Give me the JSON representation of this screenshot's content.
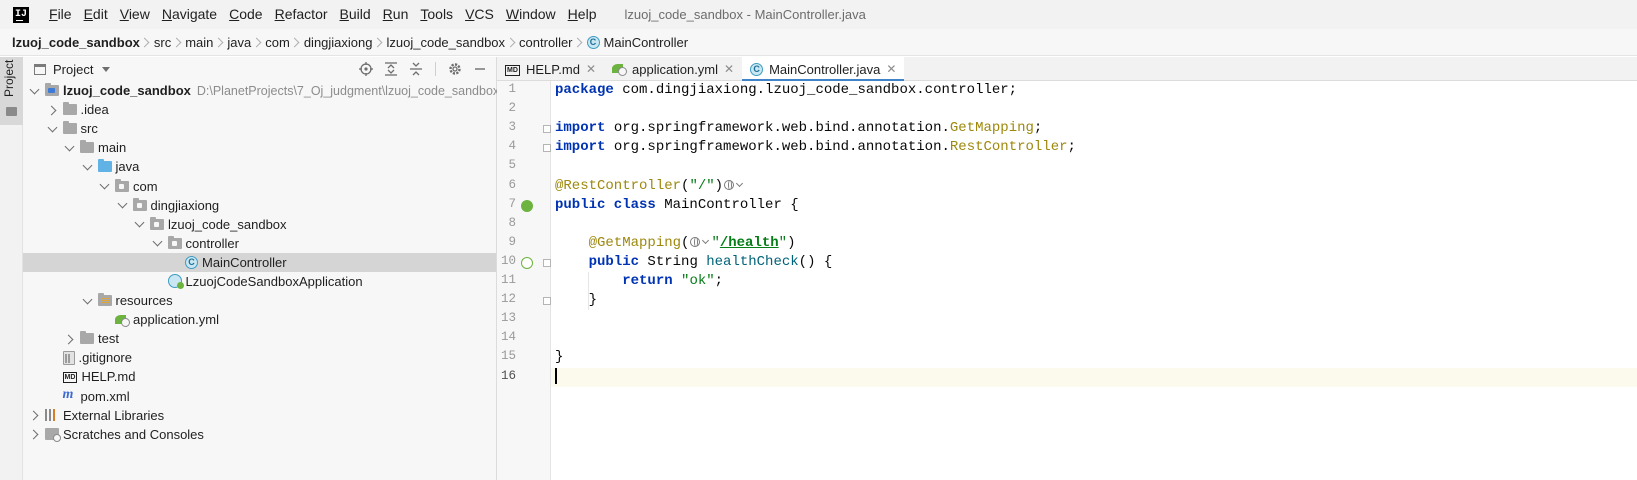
{
  "window": {
    "title": "lzuoj_code_sandbox - MainController.java",
    "logo_text": "IJ"
  },
  "menu": [
    "File",
    "Edit",
    "View",
    "Navigate",
    "Code",
    "Refactor",
    "Build",
    "Run",
    "Tools",
    "VCS",
    "Window",
    "Help"
  ],
  "breadcrumb": [
    "lzuoj_code_sandbox",
    "src",
    "main",
    "java",
    "com",
    "dingjiaxiong",
    "lzuoj_code_sandbox",
    "controller",
    "MainController"
  ],
  "toolstrip": {
    "label": "Project"
  },
  "project_panel": {
    "title": "Project",
    "tree": [
      {
        "label": "lzuoj_code_sandbox",
        "path": "D:\\PlanetProjects\\7_Oj_judgment\\lzuoj_code_sandbox",
        "depth": 0,
        "arrow": "open",
        "icon": "folder-mod",
        "bold": true
      },
      {
        "label": ".idea",
        "depth": 1,
        "arrow": "closed",
        "icon": "folder"
      },
      {
        "label": "src",
        "depth": 1,
        "arrow": "open",
        "icon": "folder"
      },
      {
        "label": "main",
        "depth": 2,
        "arrow": "open",
        "icon": "folder"
      },
      {
        "label": "java",
        "depth": 3,
        "arrow": "open",
        "icon": "folder-blue"
      },
      {
        "label": "com",
        "depth": 4,
        "arrow": "open",
        "icon": "folder-pkg"
      },
      {
        "label": "dingjiaxiong",
        "depth": 5,
        "arrow": "open",
        "icon": "folder-pkg"
      },
      {
        "label": "lzuoj_code_sandbox",
        "depth": 6,
        "arrow": "open",
        "icon": "folder-pkg"
      },
      {
        "label": "controller",
        "depth": 7,
        "arrow": "open",
        "icon": "folder-pkg"
      },
      {
        "label": "MainController",
        "depth": 8,
        "arrow": "none",
        "icon": "cls",
        "selected": true
      },
      {
        "label": "LzuojCodeSandboxApplication",
        "depth": 7,
        "arrow": "none",
        "icon": "spring-cls"
      },
      {
        "label": "resources",
        "depth": 3,
        "arrow": "open",
        "icon": "folder-res"
      },
      {
        "label": "application.yml",
        "depth": 4,
        "arrow": "none",
        "icon": "yml"
      },
      {
        "label": "test",
        "depth": 2,
        "arrow": "closed",
        "icon": "folder"
      },
      {
        "label": ".gitignore",
        "depth": 1,
        "arrow": "none",
        "icon": "gitignore"
      },
      {
        "label": "HELP.md",
        "depth": 1,
        "arrow": "none",
        "icon": "md"
      },
      {
        "label": "pom.xml",
        "depth": 1,
        "arrow": "none",
        "icon": "maven"
      },
      {
        "label": "External Libraries",
        "depth": 0,
        "arrow": "closed",
        "icon": "libs"
      },
      {
        "label": "Scratches and Consoles",
        "depth": 0,
        "arrow": "closed",
        "icon": "scratch"
      }
    ]
  },
  "editor_tabs": [
    {
      "label": "HELP.md",
      "icon": "md",
      "active": false
    },
    {
      "label": "application.yml",
      "icon": "yml",
      "active": false
    },
    {
      "label": "MainController.java",
      "icon": "cls",
      "active": true
    }
  ],
  "editor": {
    "current_line": 16,
    "line_numbers": [
      "1",
      "2",
      "3",
      "4",
      "5",
      "6",
      "7",
      "8",
      "9",
      "10",
      "11",
      "12",
      "13",
      "14",
      "15",
      "16"
    ],
    "lines": [
      [
        [
          "kw",
          "package"
        ],
        [
          "plain",
          " com.dingjiaxiong.lzuoj_code_sandbox.controller;"
        ]
      ],
      [],
      [
        [
          "kw",
          "import"
        ],
        [
          "plain",
          " org.springframework.web.bind.annotation."
        ],
        [
          "ann",
          "GetMapping"
        ],
        [
          "plain",
          ";"
        ]
      ],
      [
        [
          "kw",
          "import"
        ],
        [
          "plain",
          " org.springframework.web.bind.annotation."
        ],
        [
          "ann",
          "RestController"
        ],
        [
          "plain",
          ";"
        ]
      ],
      [],
      [
        [
          "ann",
          "@RestController"
        ],
        [
          "plain",
          "("
        ],
        [
          "str",
          "\"/\""
        ],
        [
          "plain",
          ")"
        ],
        [
          "globe",
          ""
        ]
      ],
      [
        [
          "kw",
          "public class"
        ],
        [
          "plain",
          " MainController {"
        ]
      ],
      [],
      [
        [
          "plain",
          "    "
        ],
        [
          "ann",
          "@GetMapping"
        ],
        [
          "plain",
          "("
        ],
        [
          "globe",
          ""
        ],
        [
          "str",
          "\""
        ],
        [
          "str-u",
          "/health"
        ],
        [
          "str",
          "\""
        ],
        [
          "plain",
          ")"
        ]
      ],
      [
        [
          "plain",
          "    "
        ],
        [
          "kw",
          "public"
        ],
        [
          "plain",
          " String "
        ],
        [
          "fn",
          "healthCheck"
        ],
        [
          "plain",
          "() {"
        ]
      ],
      [
        [
          "plain",
          "        "
        ],
        [
          "kw",
          "return"
        ],
        [
          "plain",
          " "
        ],
        [
          "str",
          "\"ok\""
        ],
        [
          "plain",
          ";"
        ]
      ],
      [
        [
          "plain",
          "    }"
        ]
      ],
      [],
      [],
      [
        [
          "plain",
          "}"
        ]
      ],
      [
        [
          "caret",
          ""
        ]
      ]
    ]
  }
}
